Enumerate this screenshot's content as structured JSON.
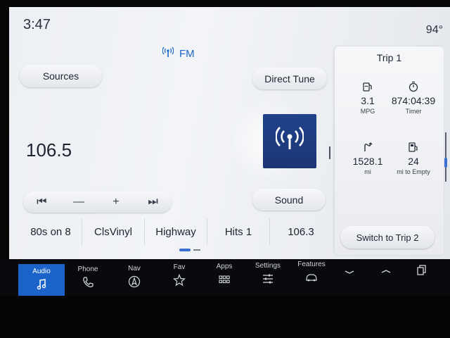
{
  "status": {
    "time": "3:47",
    "temperature": "94°"
  },
  "source": {
    "band": "FM",
    "icon": "radio-tower-icon"
  },
  "buttons": {
    "sources": "Sources",
    "direct_tune": "Direct Tune",
    "sound": "Sound"
  },
  "now_playing": {
    "frequency": "106.5",
    "art_icon": "radio-tower-icon",
    "art_color": "#1f3d82"
  },
  "transport": [
    {
      "name": "seek-back-button",
      "glyph": "⏮"
    },
    {
      "name": "tune-down-button",
      "glyph": "—"
    },
    {
      "name": "tune-up-button",
      "glyph": "+"
    },
    {
      "name": "seek-forward-button",
      "glyph": "⏭"
    }
  ],
  "presets": [
    "80s on 8",
    "ClsVinyl",
    "Highway",
    "Hits 1",
    "106.3"
  ],
  "trip": {
    "title": "Trip 1",
    "metrics": [
      {
        "value": "3.1",
        "label": "MPG",
        "icon": "fuel-gauge-icon"
      },
      {
        "value": "874:04:39",
        "label": "Timer",
        "icon": "stopwatch-icon"
      },
      {
        "value": "1528.1",
        "label": "mi",
        "icon": "route-icon"
      },
      {
        "value": "24",
        "label": "mi to Empty",
        "icon": "fuel-pump-icon"
      }
    ],
    "switch_label": "Switch to Trip 2"
  },
  "nav": {
    "items": [
      {
        "label": "Audio",
        "icon": "music-note-icon"
      },
      {
        "label": "Phone",
        "icon": "phone-icon"
      },
      {
        "label": "Nav",
        "icon": "compass-icon"
      },
      {
        "label": "Fav",
        "icon": "star-icon"
      },
      {
        "label": "Apps",
        "icon": "grid-icon"
      },
      {
        "label": "Settings",
        "icon": "sliders-icon"
      },
      {
        "label": "Features",
        "icon": "car-icon"
      }
    ],
    "accent": "#1b63c9"
  }
}
